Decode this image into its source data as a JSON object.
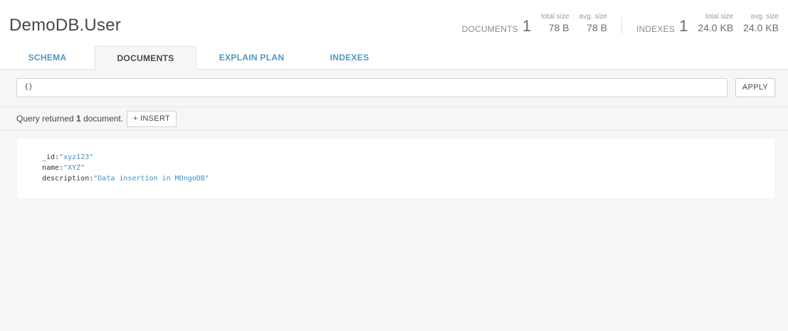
{
  "namespace": {
    "title": "DemoDB.User"
  },
  "stats": {
    "documents": {
      "label": "DOCUMENTS",
      "count": "1",
      "total_size_label": "total size",
      "total_size": "78 B",
      "avg_size_label": "avg. size",
      "avg_size": "78 B"
    },
    "indexes": {
      "label": "INDEXES",
      "count": "1",
      "total_size_label": "total size",
      "total_size": "24.0 KB",
      "avg_size_label": "avg. size",
      "avg_size": "24.0 KB"
    }
  },
  "tabs": [
    {
      "label": "SCHEMA",
      "active": false
    },
    {
      "label": "DOCUMENTS",
      "active": true
    },
    {
      "label": "EXPLAIN PLAN",
      "active": false
    },
    {
      "label": "INDEXES",
      "active": false
    }
  ],
  "query": {
    "value": "{}",
    "apply_label": "APPLY"
  },
  "results": {
    "prefix": "Query returned ",
    "count": "1",
    "suffix": " document.",
    "insert_label": "+ INSERT"
  },
  "document": {
    "fields": [
      {
        "key": "_id",
        "value": "\"xyz123\""
      },
      {
        "key": "name",
        "value": "\"XYZ\""
      },
      {
        "key": "description",
        "value": "\"Data insertion in MOngoDB\""
      }
    ]
  },
  "colors": {
    "accent": "#4f97c4",
    "background": "#f5f6f7",
    "value": "#3f8fc5"
  }
}
